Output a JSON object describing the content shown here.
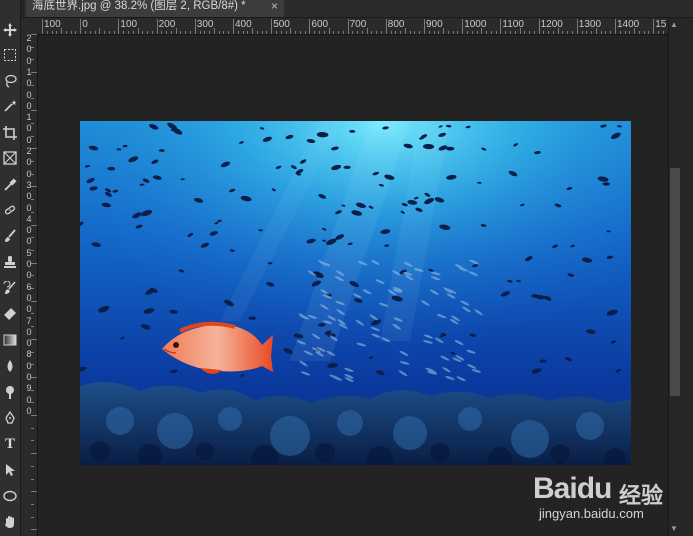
{
  "document": {
    "tab_title": "海底世界.jpg @ 38.2% (图层 2, RGB/8#) *",
    "close_glyph": "×"
  },
  "ruler": {
    "horizontal_labels": [
      "100",
      "0",
      "100",
      "200",
      "300",
      "400",
      "500",
      "600",
      "700",
      "800",
      "900",
      "1000",
      "1100",
      "1200",
      "1300",
      "1400",
      "15"
    ],
    "vertical_labels": [
      "2",
      "0",
      "0",
      "1",
      "0",
      "0",
      "0",
      "1",
      "0",
      "0",
      "2",
      "0",
      "0",
      "3",
      "0",
      "0",
      "4",
      "0",
      "0",
      "5",
      "0",
      "0",
      "6",
      "0",
      "0",
      "7",
      "0",
      "0",
      "8",
      "0",
      "0",
      "9",
      "0",
      "0"
    ]
  },
  "toolbar": {
    "tools": [
      {
        "name": "move-tool-icon"
      },
      {
        "name": "marquee-tool-icon"
      },
      {
        "name": "lasso-tool-icon"
      },
      {
        "name": "magic-wand-tool-icon"
      },
      {
        "name": "crop-tool-icon"
      },
      {
        "name": "frame-tool-icon"
      },
      {
        "name": "eyedropper-tool-icon"
      },
      {
        "name": "healing-brush-tool-icon"
      },
      {
        "name": "brush-tool-icon"
      },
      {
        "name": "clone-stamp-tool-icon"
      },
      {
        "name": "history-brush-tool-icon"
      },
      {
        "name": "eraser-tool-icon"
      },
      {
        "name": "gradient-tool-icon"
      },
      {
        "name": "blur-tool-icon"
      },
      {
        "name": "dodge-tool-icon"
      },
      {
        "name": "pen-tool-icon"
      },
      {
        "name": "type-tool-icon"
      },
      {
        "name": "path-selection-tool-icon"
      },
      {
        "name": "ellipse-tool-icon"
      },
      {
        "name": "hand-tool-icon"
      }
    ],
    "type_glyph": "T"
  },
  "watermark": {
    "brand": "Bai",
    "brand_suffix": "du",
    "label": "经验",
    "url": "jingyan.baidu.com"
  },
  "colors": {
    "workspace": "#232323",
    "water_top": "#3fd0f0",
    "water_bottom": "#0a2a8a",
    "fish": "#e8553a"
  }
}
